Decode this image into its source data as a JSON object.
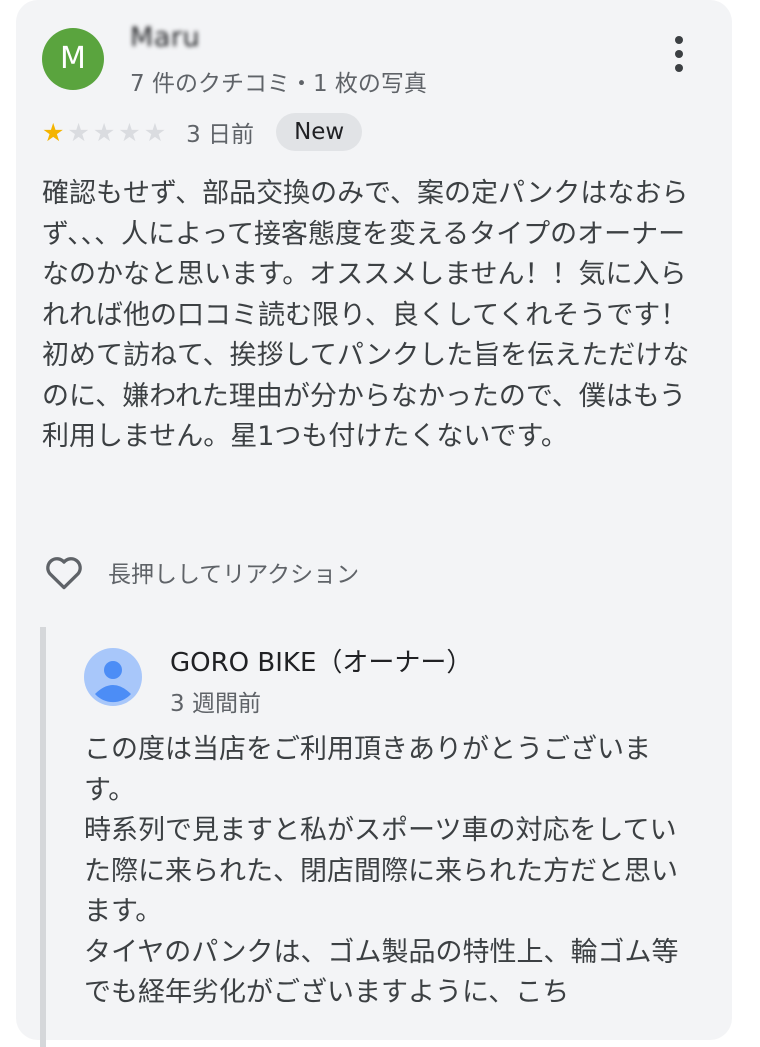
{
  "review": {
    "avatar_letter": "M",
    "author_name": "Maru",
    "author_meta": "7 件のクチコミ・1 枚の写真",
    "rating": 1,
    "rating_max": 5,
    "time": "3 日前",
    "badge": "New",
    "text": "確認もせず、部品交換のみで、案の定パンクはなおらず、、、人によって接客態度を変えるタイプのオーナーなのかなと思います。オススメしません！！気に入られれば他の口コミ読む限り、良くしてくれそうです！初めて訪ねて、挨拶してパンクした旨を伝えただけなのに、嫌われた理由が分からなかったので、僕はもう利用しません。星1つも付けたくないです。",
    "reaction_label": "長押ししてリアクション"
  },
  "owner_reply": {
    "name": "GORO BIKE（オーナー）",
    "time": "3 週間前",
    "paragraphs": [
      "この度は当店をご利用頂きありがとうございます。",
      "時系列で見ますと私がスポーツ車の対応をしていた際に来られた、閉店間際に来られた方だと思います。",
      "タイヤのパンクは、ゴム製品の特性上、輪ゴム等でも経年劣化がございますように、こち"
    ]
  },
  "colors": {
    "avatar_bg": "#5aa43e",
    "star_on": "#f4b400",
    "star_off": "#dadce0",
    "card_bg": "#f3f4f6"
  },
  "icons": {
    "more": "more-vert-icon",
    "reaction": "heart-outline-icon",
    "owner_avatar": "person-avatar-icon"
  }
}
